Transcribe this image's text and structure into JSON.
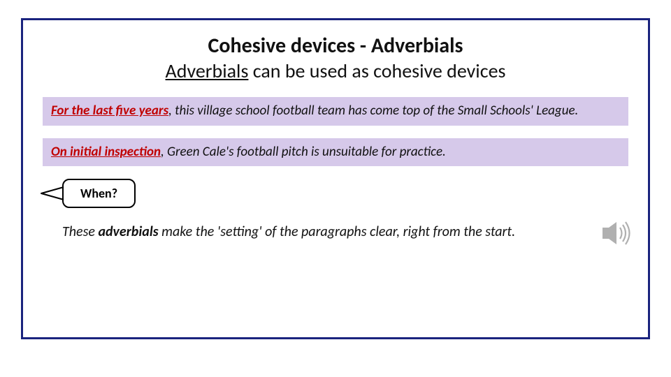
{
  "title": "Cohesive devices - Adverbials",
  "subtitle_uline": "Adverbials",
  "subtitle_rest": " can be used as cohesive devices",
  "example1": {
    "adverbial": "For the last five years",
    "rest": ", this village school football team has come top of the Small Schools' League."
  },
  "example2": {
    "adverbial": "On initial inspection",
    "rest": ", Green Cale's football pitch is unsuitable for practice."
  },
  "callout": "When?",
  "footnote_pre": "These ",
  "footnote_strong": "adverbials",
  "footnote_post": " make the 'setting' of the paragraphs clear, right from the start.",
  "icons": {
    "sound": "sound-icon"
  },
  "colors": {
    "border": "#1a237e",
    "adverbial": "#c00000",
    "example_bg": "#d6c9ea"
  }
}
